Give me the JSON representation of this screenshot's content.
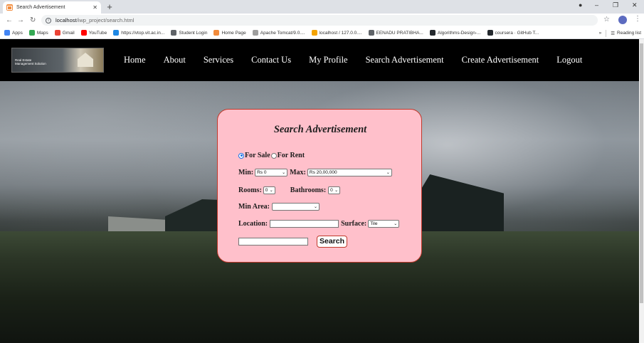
{
  "browser": {
    "tab_title": "Search Advertisement",
    "url_host": "localhost",
    "url_path": "/iwp_project/search.html",
    "bookmarks": [
      {
        "label": "Apps",
        "color": "#4285f4"
      },
      {
        "label": "Maps",
        "color": "#34a853"
      },
      {
        "label": "Gmail",
        "color": "#ea4335"
      },
      {
        "label": "YouTube",
        "color": "#ff0000"
      },
      {
        "label": "https://vtop.vit.ac.in...",
        "color": "#1e88e5"
      },
      {
        "label": "Student Login",
        "color": "#5f6368"
      },
      {
        "label": "Home Page",
        "color": "#f28b3b"
      },
      {
        "label": "Apache Tomcat/9.0....",
        "color": "#9e9e9e"
      },
      {
        "label": "localhost / 127.0.0....",
        "color": "#f4a300"
      },
      {
        "label": "EENADU PRATIBHA...",
        "color": "#5f6368"
      },
      {
        "label": "Algorithms-Design-...",
        "color": "#24292e"
      },
      {
        "label": "coursera · GitHub T...",
        "color": "#24292e"
      }
    ],
    "more_bookmarks": "»",
    "reading_list": "Reading list"
  },
  "site": {
    "logo_text": "Real Estate Management Solution",
    "nav": [
      "Home",
      "About",
      "Services",
      "Contact Us",
      "My Profile",
      "Search Advertisement",
      "Create Advertisement",
      "Logout"
    ]
  },
  "form": {
    "title": "Search Advertisement",
    "for_sale": "For Sale",
    "for_rent": "For Rent",
    "selected_listing": "For Sale",
    "min_label": "Min:",
    "min_value": "Rs 0",
    "max_label": "Max:",
    "max_value": "Rs 20,00,000",
    "rooms_label": "Rooms:",
    "rooms_value": "0",
    "bathrooms_label": "Bathrooms:",
    "bathrooms_value": "0",
    "min_area_label": "Min Area:",
    "min_area_value": "",
    "location_label": "Location:",
    "location_value": "",
    "surface_label": "Surface:",
    "surface_value": "Tile",
    "search_value": "",
    "search_button": "Search"
  }
}
